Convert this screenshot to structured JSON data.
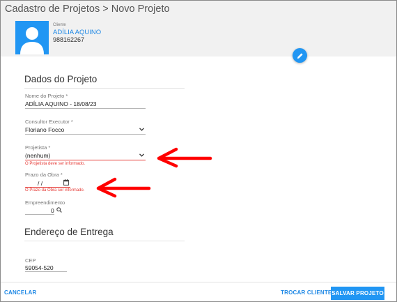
{
  "header": {
    "breadcrumb": "Cadastro de Projetos > Novo Projeto"
  },
  "client": {
    "caption": "Cliente",
    "name": "ADÍLIA AQUINO",
    "phone": "988162267",
    "avatar_icon": "person-icon",
    "edit_icon": "pencil-icon"
  },
  "sections": {
    "project_title": "Dados do Projeto",
    "delivery_title": "Endereço de Entrega"
  },
  "form": {
    "project_name": {
      "label": "Nome do Projeto *",
      "value": "ADÍLIA AQUINO - 18/08/23"
    },
    "consultant": {
      "label": "Consultor Executor *",
      "value": "Floriano Focco"
    },
    "designer": {
      "label": "Projetista *",
      "value": "(nenhum)",
      "error": "O Projetista deve ser informado."
    },
    "deadline": {
      "label": "Prazo da Obra *",
      "value": "/ /",
      "error": "O Prazo da Obra ser informado."
    },
    "development": {
      "label": "Empreendimento",
      "value": "0"
    },
    "cep": {
      "label": "CEP",
      "value": "59054-520"
    }
  },
  "footer": {
    "cancel": "CANCELAR",
    "change_client": "TROCAR CLIENTE",
    "save": "SALVAR PROJETO"
  },
  "colors": {
    "accent": "#2196f3",
    "error": "#e53935",
    "annotation": "#ff0000"
  }
}
